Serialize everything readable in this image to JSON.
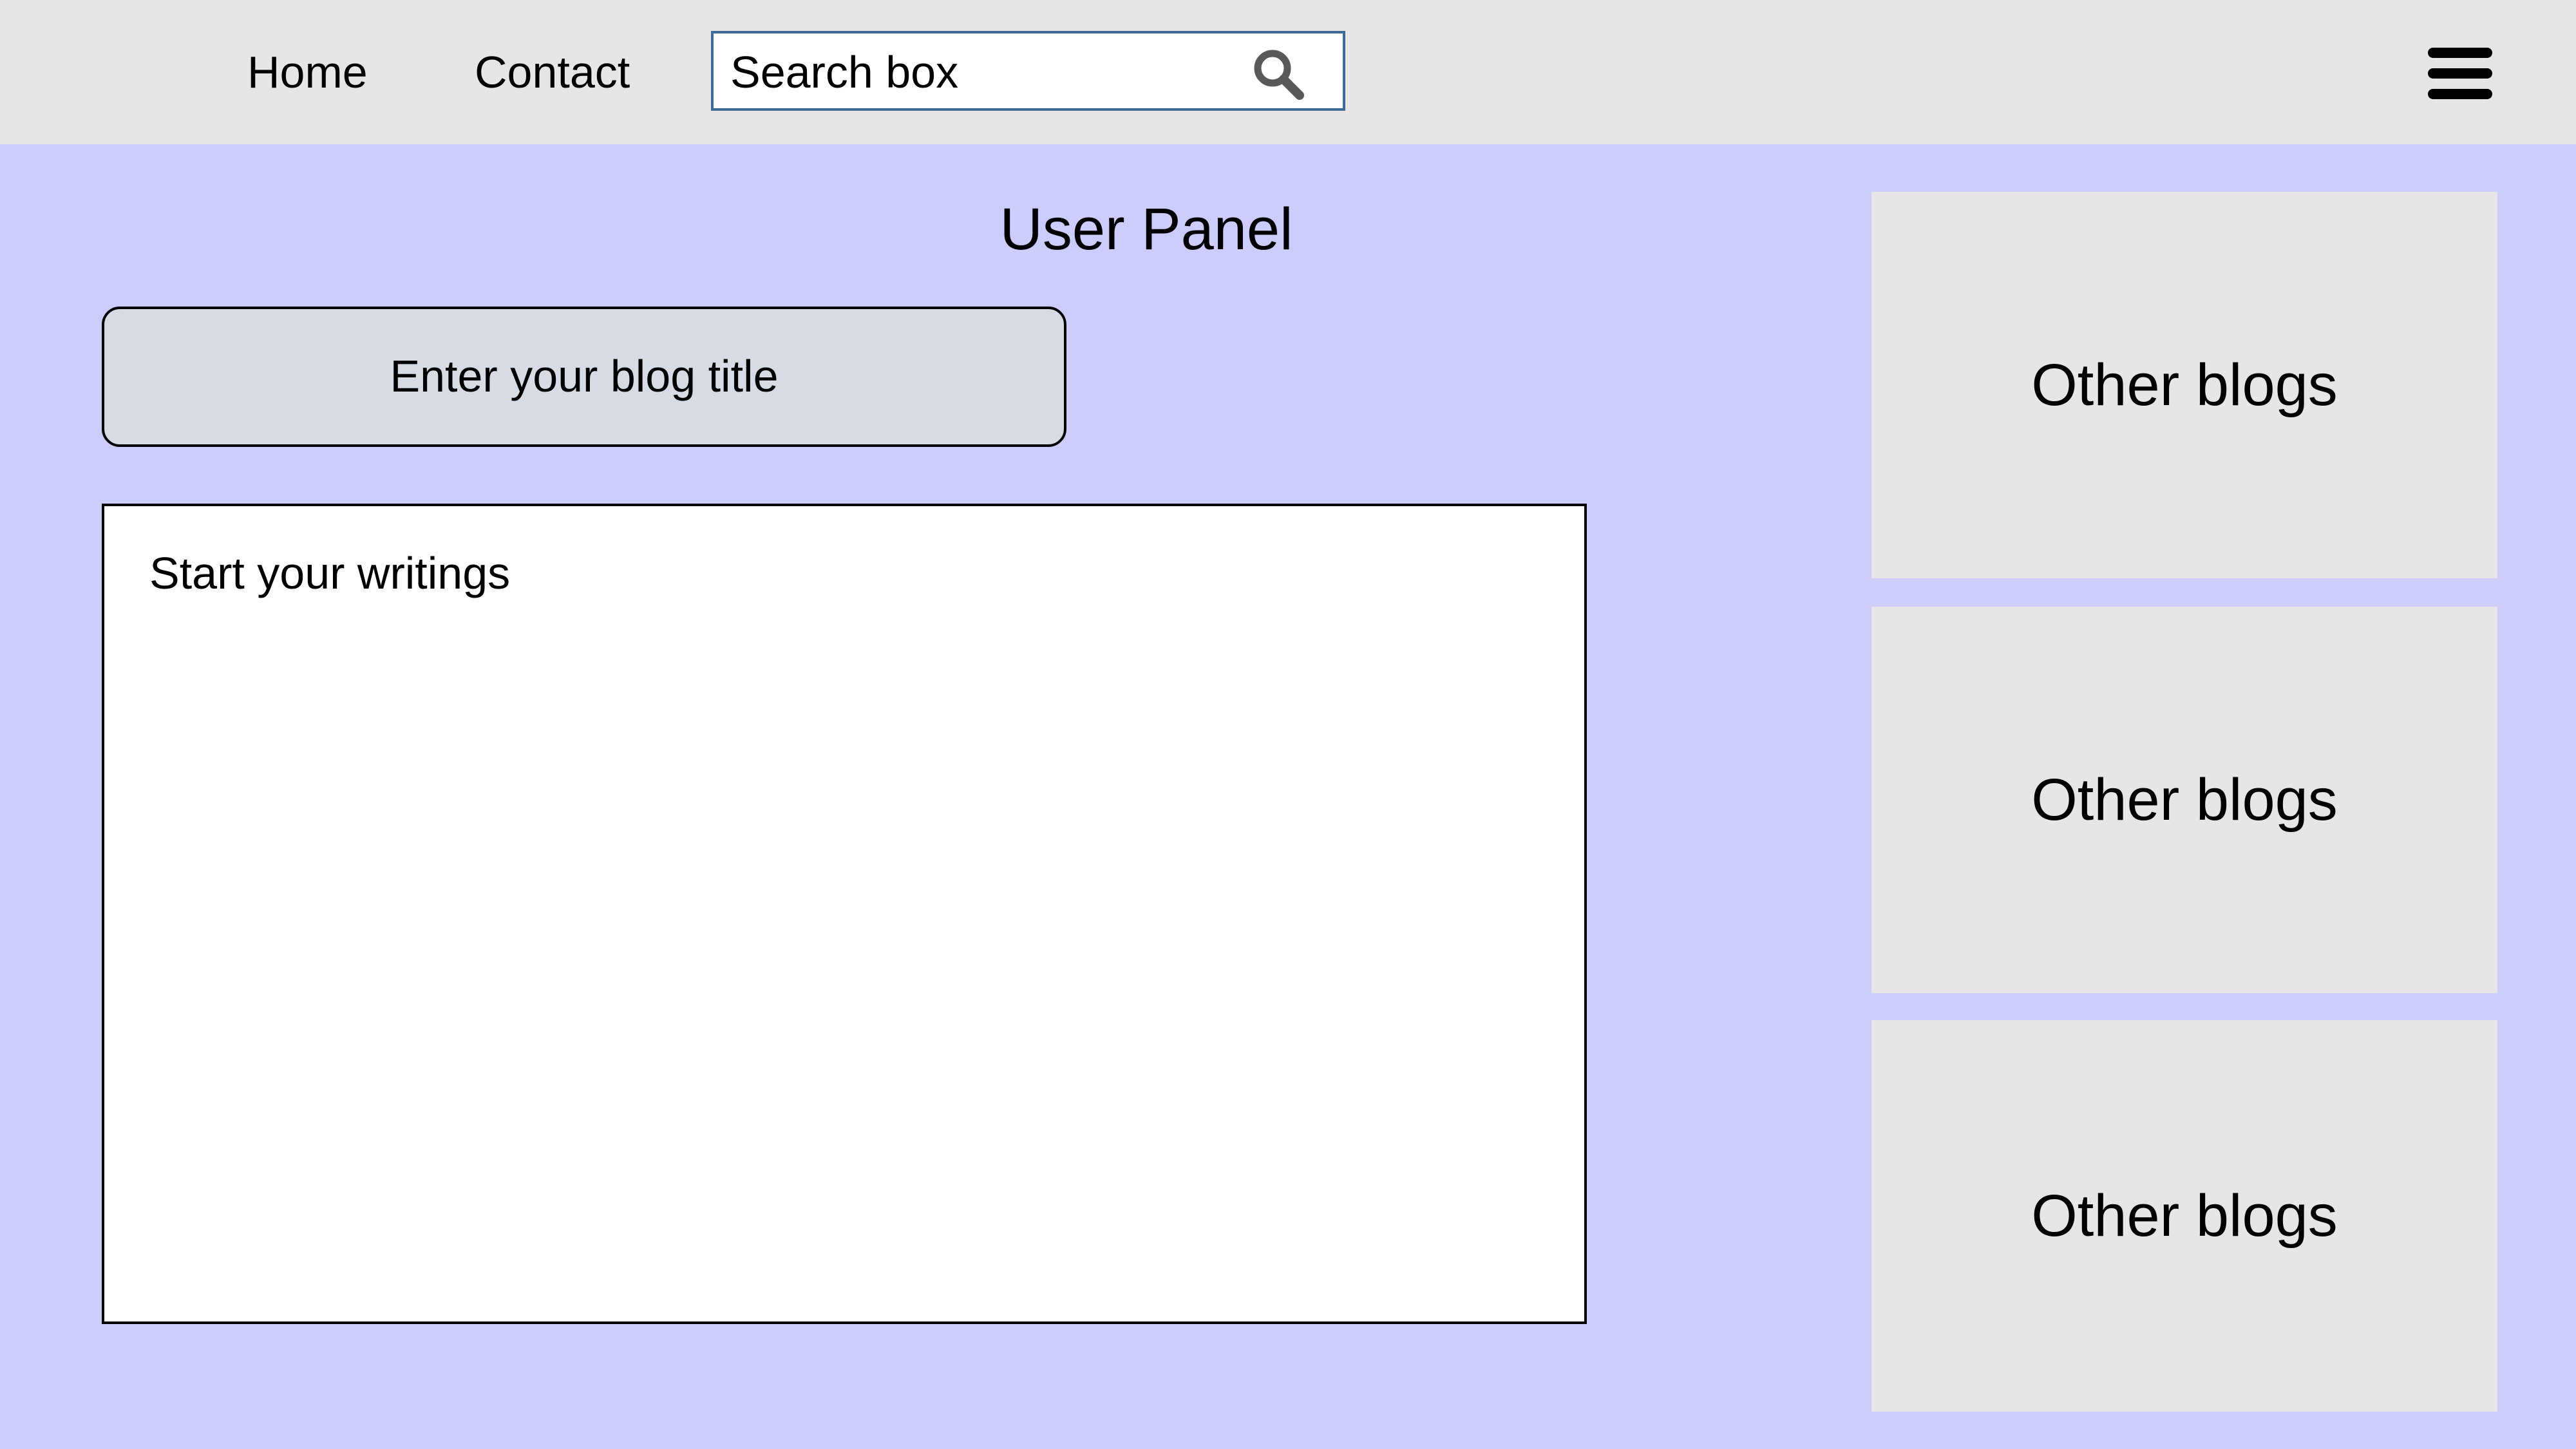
{
  "header": {
    "nav": {
      "home": "Home",
      "contact": "Contact"
    },
    "search": {
      "placeholder": "Search box",
      "icon": "search-icon"
    },
    "menu_icon": "hamburger-menu-icon"
  },
  "main": {
    "title": "User Panel",
    "blog_title_field": {
      "placeholder": "Enter your blog title"
    },
    "editor": {
      "placeholder": "Start your writings"
    }
  },
  "sidebar": {
    "cards": [
      {
        "label": "Other blogs"
      },
      {
        "label": "Other blogs"
      },
      {
        "label": "Other blogs"
      }
    ]
  },
  "colors": {
    "page_background": "#ccccfd",
    "topbar_background": "#e7e5e6",
    "search_border": "#3e6b9a",
    "title_field_background": "#d6dbe4",
    "card_background": "#e7e5e6",
    "search_icon_color": "#595959"
  }
}
